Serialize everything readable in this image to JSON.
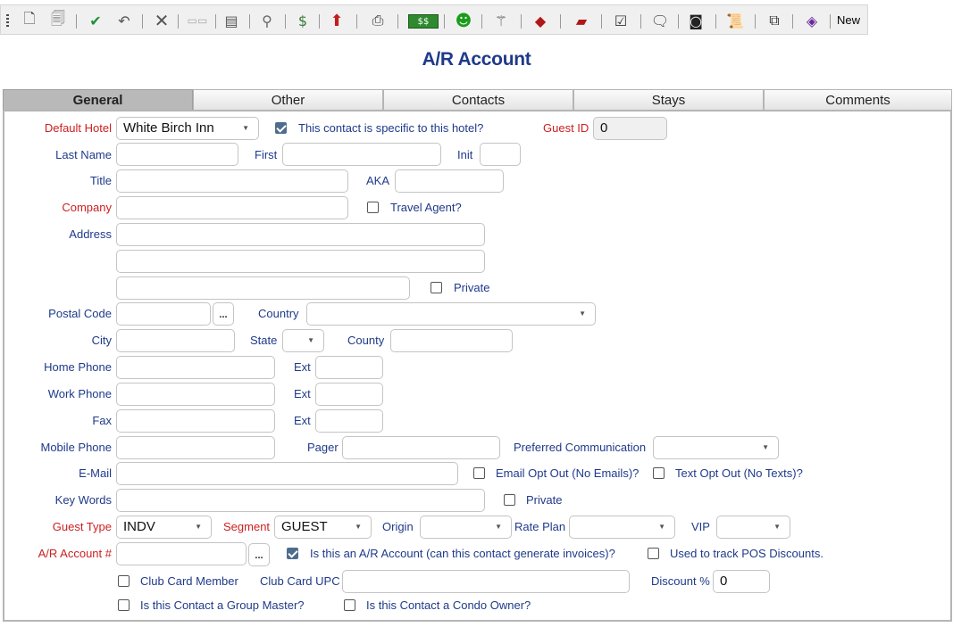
{
  "toolbar": {
    "new_label": "New",
    "icons": [
      "new-document-icon",
      "copy-document-icon",
      "save-check-icon",
      "undo-icon",
      "delete-icon",
      "toggle-icon",
      "notes-icon",
      "search-add-icon",
      "money-icon",
      "export-icon",
      "print-icon",
      "cash-icon",
      "smiley-icon",
      "magic-wand-icon",
      "book-icon",
      "folder-icon",
      "checklist-icon",
      "comment-icon",
      "camera-icon",
      "scroll-icon",
      "copy-pages-icon",
      "book-purple-icon"
    ]
  },
  "page_title": "A/R Account",
  "tabs": [
    "General",
    "Other",
    "Contacts",
    "Stays",
    "Comments"
  ],
  "form": {
    "default_hotel": {
      "label": "Default Hotel",
      "value": "White Birch Inn"
    },
    "specific_hotel": {
      "label": "This contact is specific to this hotel?",
      "checked": true
    },
    "guest_id": {
      "label": "Guest ID",
      "value": "0"
    },
    "last_name": {
      "label": "Last Name",
      "value": ""
    },
    "first": {
      "label": "First",
      "value": ""
    },
    "init": {
      "label": "Init",
      "value": ""
    },
    "title": {
      "label": "Title",
      "value": ""
    },
    "aka": {
      "label": "AKA",
      "value": ""
    },
    "company": {
      "label": "Company",
      "value": ""
    },
    "travel_agent": {
      "label": "Travel Agent?",
      "checked": false
    },
    "address": {
      "label": "Address"
    },
    "private1": {
      "label": "Private",
      "checked": false
    },
    "postal_code": {
      "label": "Postal Code",
      "button": "..."
    },
    "country": {
      "label": "Country",
      "value": ""
    },
    "city": {
      "label": "City"
    },
    "state": {
      "label": "State"
    },
    "county": {
      "label": "County"
    },
    "home_phone": {
      "label": "Home Phone"
    },
    "work_phone": {
      "label": "Work Phone"
    },
    "fax": {
      "label": "Fax"
    },
    "ext": "Ext",
    "mobile_phone": {
      "label": "Mobile Phone"
    },
    "pager": {
      "label": "Pager"
    },
    "preferred_comm": {
      "label": "Preferred Communication",
      "value": ""
    },
    "email": {
      "label": "E-Mail"
    },
    "email_opt_out": {
      "label": "Email Opt Out (No Emails)?",
      "checked": false
    },
    "text_opt_out": {
      "label": "Text Opt Out (No Texts)?",
      "checked": false
    },
    "key_words": {
      "label": "Key Words"
    },
    "private2": {
      "label": "Private",
      "checked": false
    },
    "guest_type": {
      "label": "Guest Type",
      "value": "INDV"
    },
    "segment": {
      "label": "Segment",
      "value": "GUEST"
    },
    "origin": {
      "label": "Origin",
      "value": ""
    },
    "rate_plan": {
      "label": "Rate Plan",
      "value": ""
    },
    "vip": {
      "label": "VIP",
      "value": ""
    },
    "ar_account": {
      "label": "A/R Account #",
      "button": "..."
    },
    "is_ar_account": {
      "label": "Is this an A/R Account (can this contact generate invoices)?",
      "checked": true
    },
    "pos_discounts": {
      "label": "Used to track POS Discounts.",
      "checked": false
    },
    "club_card_member": {
      "label": "Club Card Member",
      "checked": false
    },
    "club_card_upc": {
      "label": "Club Card UPC"
    },
    "discount": {
      "label": "Discount %",
      "value": "0"
    },
    "group_master": {
      "label": "Is this Contact a Group Master?",
      "checked": false
    },
    "condo_owner": {
      "label": "Is this Contact a Condo Owner?",
      "checked": false
    }
  }
}
